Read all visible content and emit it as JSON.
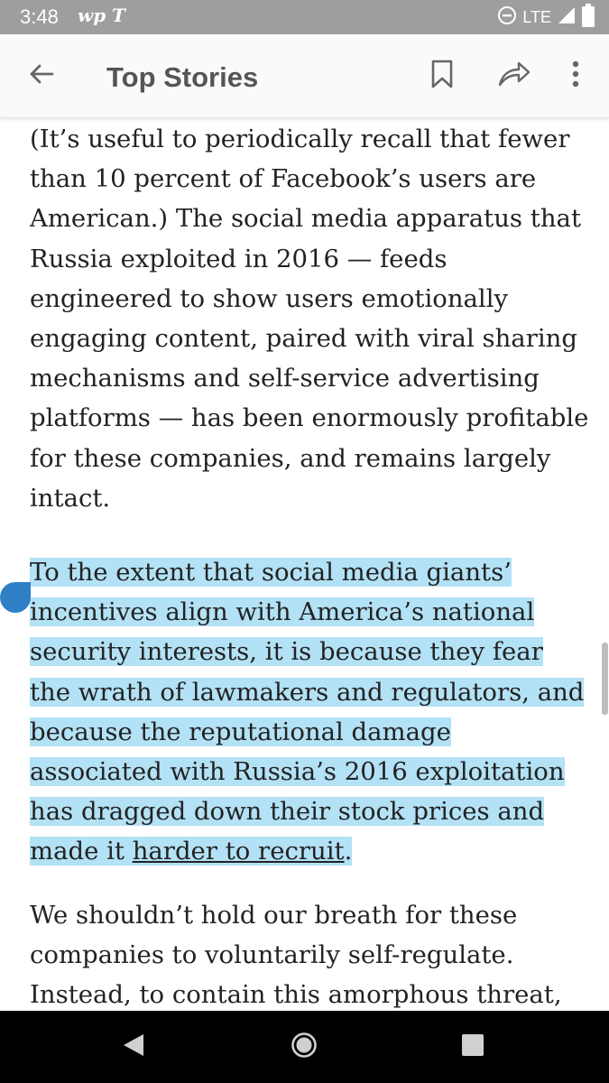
{
  "status_bar": {
    "time": "3:48",
    "app_icon_1": "wp",
    "app_icon_2": "T",
    "network": "LTE",
    "icons": [
      "do-not-disturb-icon",
      "signal-icon",
      "battery-icon"
    ]
  },
  "app_bar": {
    "title": "Top Stories",
    "icons": [
      "back-arrow-icon",
      "bookmark-icon",
      "share-icon",
      "overflow-menu-icon"
    ]
  },
  "article": {
    "paragraph_1": "(It’s useful to periodically recall that fewer than 10 percent of Facebook’s users are American.) The social media apparatus that Russia exploited in 2016 — feeds engineered to show users emotionally engaging content, paired with viral sharing mechanisms and self-service advertising platforms — has been enormously profitable for these companies, and remains largely intact.",
    "paragraph_2_selected": "To the extent that social media giants’ incentives align with America’s national security interests, it is because they fear the wrath of lawmakers and regulators, and because the reputational damage associated with Russia’s 2016 exploitation has dragged down their stock prices and made it ",
    "paragraph_2_link": "harder to recruit",
    "paragraph_2_end": ".",
    "paragraph_3": "We shouldn’t hold our breath for these companies to voluntarily self-regulate. Instead, to contain this amorphous threat,"
  },
  "colors": {
    "selection": "#b3e1f5",
    "selection_handle": "#2f80c6",
    "status_bar": "#9e9e9e",
    "nav_bar": "#000000"
  },
  "nav_bar": {
    "icons": [
      "back-triangle-icon",
      "home-circle-icon",
      "recents-square-icon"
    ]
  }
}
